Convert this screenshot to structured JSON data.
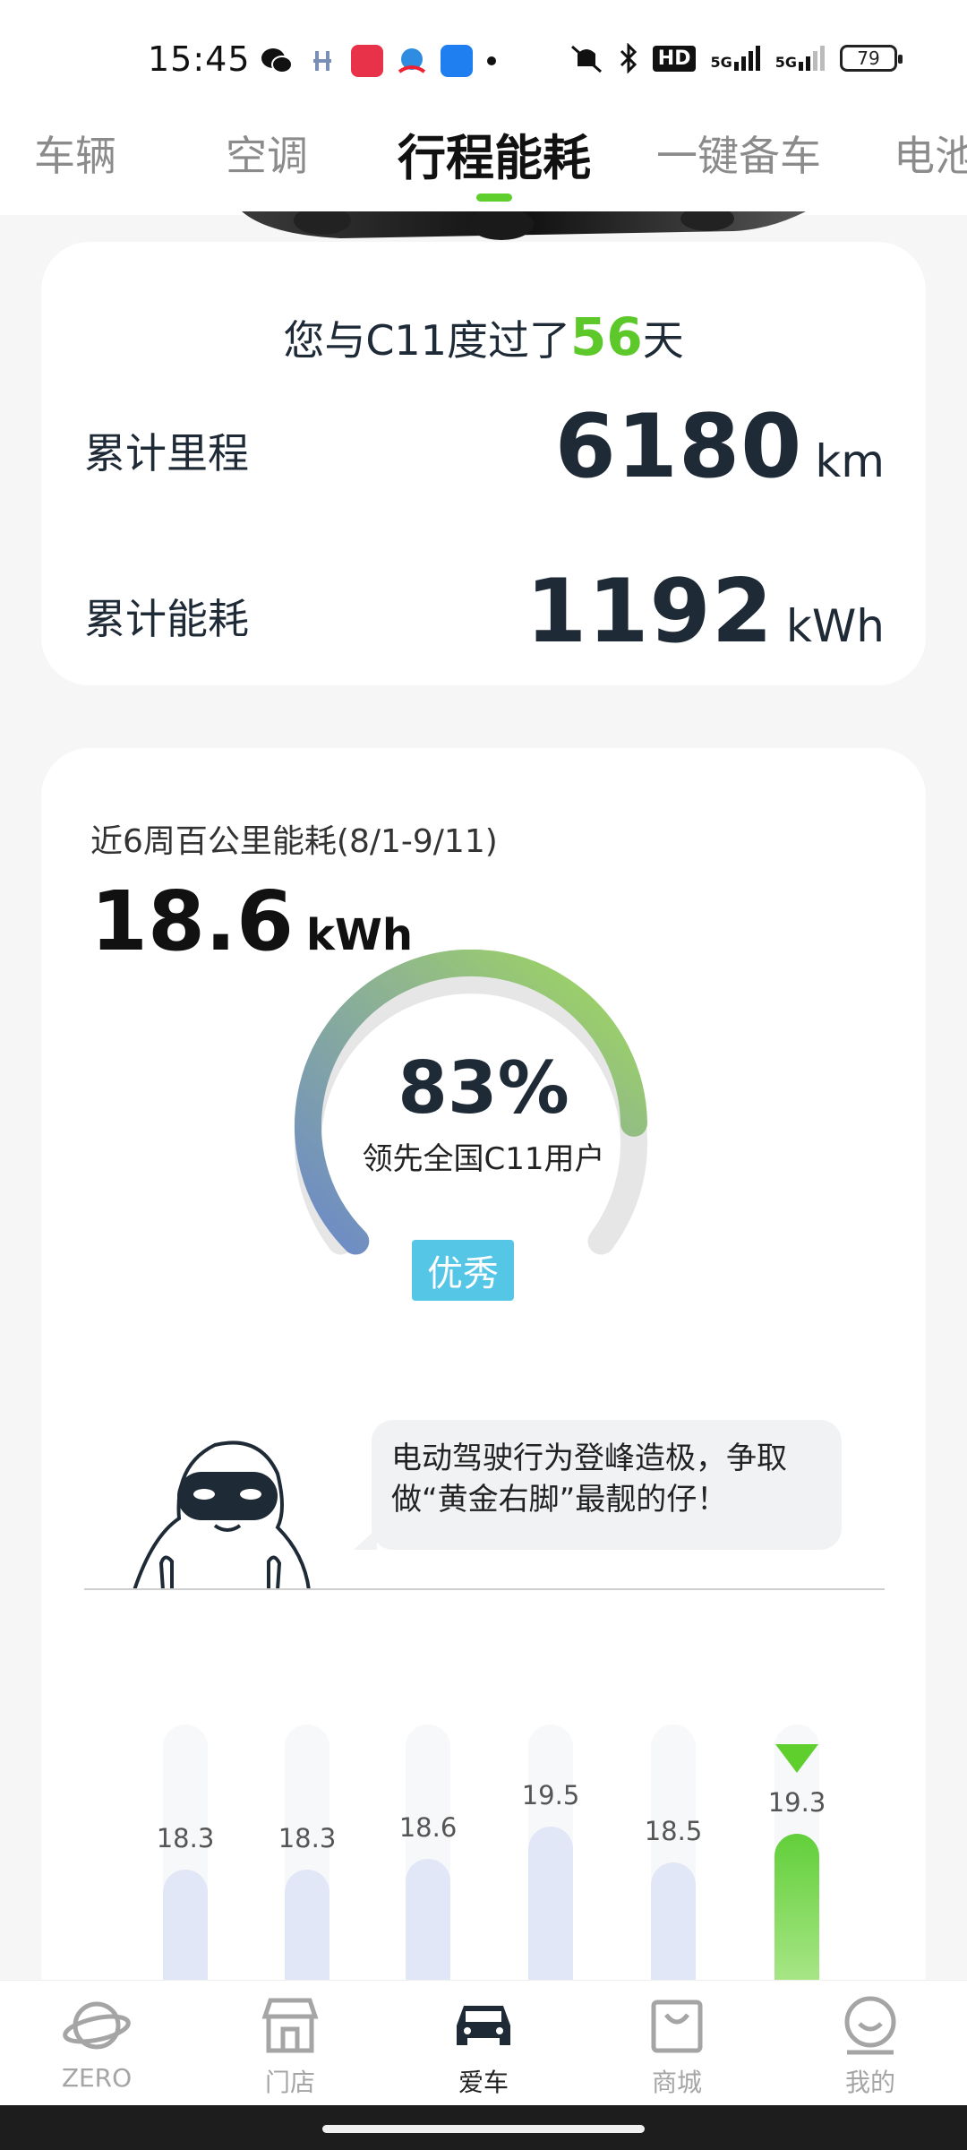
{
  "status_bar": {
    "time": "15:45",
    "battery": "79",
    "hd_label": "HD",
    "signal_labels": [
      "5G",
      "5G"
    ]
  },
  "tabs": [
    {
      "label": "车辆"
    },
    {
      "label": "空调"
    },
    {
      "label": "行程能耗",
      "active": true
    },
    {
      "label": "一键备车"
    },
    {
      "label": "电池"
    }
  ],
  "summary": {
    "days_prefix": "您与C11度过了",
    "days": "56",
    "days_suffix": "天",
    "mileage_label": "累计里程",
    "mileage_value": "6180",
    "mileage_unit": "km",
    "energy_label": "累计能耗",
    "energy_value": "1192",
    "energy_unit": "kWh"
  },
  "consumption": {
    "period_label": "近6周百公里能耗(8/1-9/11)",
    "avg_value": "18.6",
    "avg_unit": "kWh",
    "percent": "83%",
    "percent_fraction": 0.83,
    "rank_text": "领先全国C11用户",
    "rating": "优秀",
    "tip_line1": "电动驾驶行为登峰造极，争取",
    "tip_line2": "做“黄金右脚”最靓的仔！"
  },
  "chart_data": {
    "type": "bar",
    "values": [
      18.3,
      18.3,
      18.6,
      19.5,
      18.5,
      19.3
    ],
    "labels": [
      "18.3",
      "18.3",
      "18.6",
      "19.5",
      "18.5",
      "19.3"
    ],
    "current_index": 5
  },
  "bottom_nav": [
    {
      "label": "ZERO",
      "icon": "planet-icon"
    },
    {
      "label": "门店",
      "icon": "store-icon"
    },
    {
      "label": "爱车",
      "icon": "car-icon",
      "active": true
    },
    {
      "label": "商城",
      "icon": "shopping-bag-icon"
    },
    {
      "label": "我的",
      "icon": "smile-face-icon"
    }
  ],
  "colors": {
    "accent_green": "#5fcf2d",
    "rating_blue": "#56c6e6",
    "gauge_start": "#6c8ac8",
    "gauge_end": "#9fda5a"
  }
}
